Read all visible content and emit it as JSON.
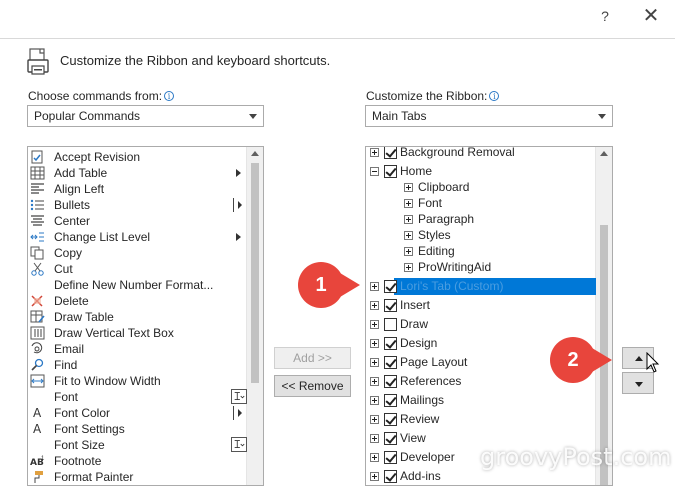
{
  "window": {
    "help_glyph": "?",
    "close_glyph": "✕"
  },
  "header": {
    "text": "Customize the Ribbon and keyboard shortcuts.",
    "icon": "ribbon-customize-icon"
  },
  "left": {
    "label": "Choose commands from:",
    "combo_value": "Popular Commands",
    "items": [
      {
        "label": "Accept Revision",
        "icon": "accept-revision-icon"
      },
      {
        "label": "Add Table",
        "icon": "table-icon",
        "submenu": true
      },
      {
        "label": "Align Left",
        "icon": "align-left-icon"
      },
      {
        "label": "Bullets",
        "icon": "bullets-icon",
        "split": true
      },
      {
        "label": "Center",
        "icon": "center-icon"
      },
      {
        "label": "Change List Level",
        "icon": "list-level-icon",
        "submenu": true
      },
      {
        "label": "Copy",
        "icon": "copy-icon"
      },
      {
        "label": "Cut",
        "icon": "cut-icon"
      },
      {
        "label": "Define New Number Format...",
        "icon": ""
      },
      {
        "label": "Delete",
        "icon": "delete-icon"
      },
      {
        "label": "Draw Table",
        "icon": "draw-table-icon"
      },
      {
        "label": "Draw Vertical Text Box",
        "icon": "text-box-icon"
      },
      {
        "label": "Email",
        "icon": "email-icon"
      },
      {
        "label": "Find",
        "icon": "find-icon"
      },
      {
        "label": "Fit to Window Width",
        "icon": "fit-width-icon"
      },
      {
        "label": "Font",
        "icon": "",
        "control": true
      },
      {
        "label": "Font Color",
        "icon": "font-color-icon",
        "split": true
      },
      {
        "label": "Font Settings",
        "icon": "font-settings-icon"
      },
      {
        "label": "Font Size",
        "icon": "",
        "control": true
      },
      {
        "label": "Footnote",
        "icon": "footnote-icon"
      },
      {
        "label": "Format Painter",
        "icon": "format-painter-icon"
      }
    ]
  },
  "middle": {
    "add_label": "Add >>",
    "remove_label": "<< Remove"
  },
  "right": {
    "label": "Customize the Ribbon:",
    "combo_value": "Main Tabs",
    "items": [
      {
        "label": "Background Removal",
        "level": 0,
        "checked": true,
        "expanded": false
      },
      {
        "label": "Home",
        "level": 0,
        "checked": true,
        "expanded": true
      },
      {
        "label": "Clipboard",
        "level": 1
      },
      {
        "label": "Font",
        "level": 1
      },
      {
        "label": "Paragraph",
        "level": 1
      },
      {
        "label": "Styles",
        "level": 1
      },
      {
        "label": "Editing",
        "level": 1
      },
      {
        "label": "ProWritingAid",
        "level": 1
      },
      {
        "label": "Lori's Tab (Custom)",
        "level": 0,
        "checked": true,
        "expanded": false,
        "selected": true
      },
      {
        "label": "Insert",
        "level": 0,
        "checked": true,
        "expanded": false
      },
      {
        "label": "Draw",
        "level": 0,
        "checked": false,
        "expanded": false
      },
      {
        "label": "Design",
        "level": 0,
        "checked": true,
        "expanded": false
      },
      {
        "label": "Page Layout",
        "level": 0,
        "checked": true,
        "expanded": false
      },
      {
        "label": "References",
        "level": 0,
        "checked": true,
        "expanded": false
      },
      {
        "label": "Mailings",
        "level": 0,
        "checked": true,
        "expanded": false
      },
      {
        "label": "Review",
        "level": 0,
        "checked": true,
        "expanded": false
      },
      {
        "label": "View",
        "level": 0,
        "checked": true,
        "expanded": false
      },
      {
        "label": "Developer",
        "level": 0,
        "checked": true,
        "expanded": false
      },
      {
        "label": "Add-ins",
        "level": 0,
        "checked": true,
        "expanded": false
      }
    ]
  },
  "callouts": {
    "one": "1",
    "two": "2"
  },
  "watermark": "groovyPost.com",
  "colors": {
    "selection": "#0078d7",
    "callout": "#e8453c",
    "info": "#2b78c5"
  }
}
